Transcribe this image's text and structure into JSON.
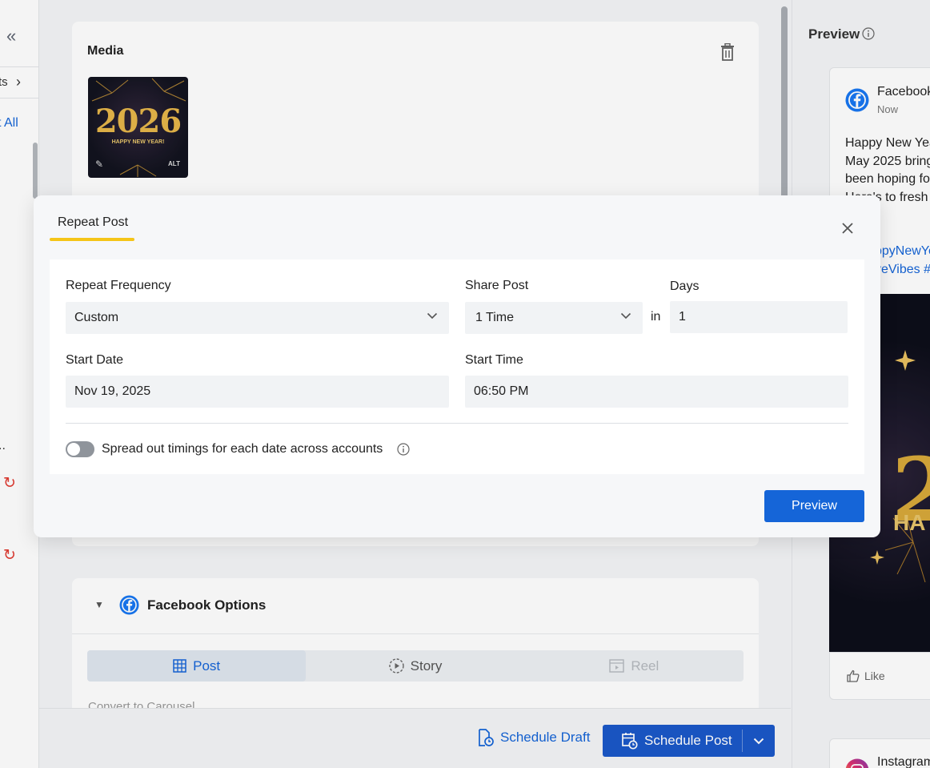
{
  "sidebar": {
    "collapse_icon": "«",
    "partial_item": "ts",
    "chevron": "›",
    "partial_link": "t All",
    "partial_ellipsis": "..",
    "refresh_glyph": "↻"
  },
  "composer": {
    "media_title": "Media",
    "thumbnail": {
      "year_text": "2026",
      "sub_text": "HAPPY NEW YEAR!",
      "alt_badge": "ALT"
    },
    "facebook_options": {
      "title": "Facebook Options",
      "tabs": [
        {
          "label": "Post",
          "state": "active"
        },
        {
          "label": "Story",
          "state": "normal"
        },
        {
          "label": "Reel",
          "state": "disabled"
        }
      ],
      "convert_label": "Convert to Carousel"
    }
  },
  "footer": {
    "schedule_draft_label": "Schedule Draft",
    "schedule_post_label": "Schedule Post"
  },
  "preview_panel": {
    "title": "Preview",
    "facebook_card": {
      "name": "Facebook",
      "time": "Now",
      "text_lines": [
        "Happy New Year",
        "May 2025 bring",
        "been hoping fo",
        "Here's to fresh"
      ],
      "hashtag_lines": [
        "ppyNewYe",
        "veVibes #"
      ],
      "image_year": "2",
      "image_sub": "HA",
      "like_label": "Like"
    },
    "instagram_card": {
      "name": "Instagram"
    }
  },
  "modal": {
    "tab_label": "Repeat Post",
    "repeat_frequency": {
      "label": "Repeat Frequency",
      "value": "Custom"
    },
    "share_post": {
      "label": "Share Post",
      "value": "1 Time"
    },
    "in_label": "in",
    "days": {
      "label": "Days",
      "value": "1"
    },
    "start_date": {
      "label": "Start Date",
      "value": "Nov 19, 2025"
    },
    "start_time": {
      "label": "Start Time",
      "value": "06:50 PM"
    },
    "spread_toggle": {
      "label": "Spread out timings for each date across accounts",
      "on": false
    },
    "preview_button": "Preview"
  },
  "colors": {
    "accent_blue": "#1565d8",
    "schedule_blue": "#1b58c9",
    "tab_underline": "#f5c518",
    "refresh_red": "#e03b32"
  }
}
